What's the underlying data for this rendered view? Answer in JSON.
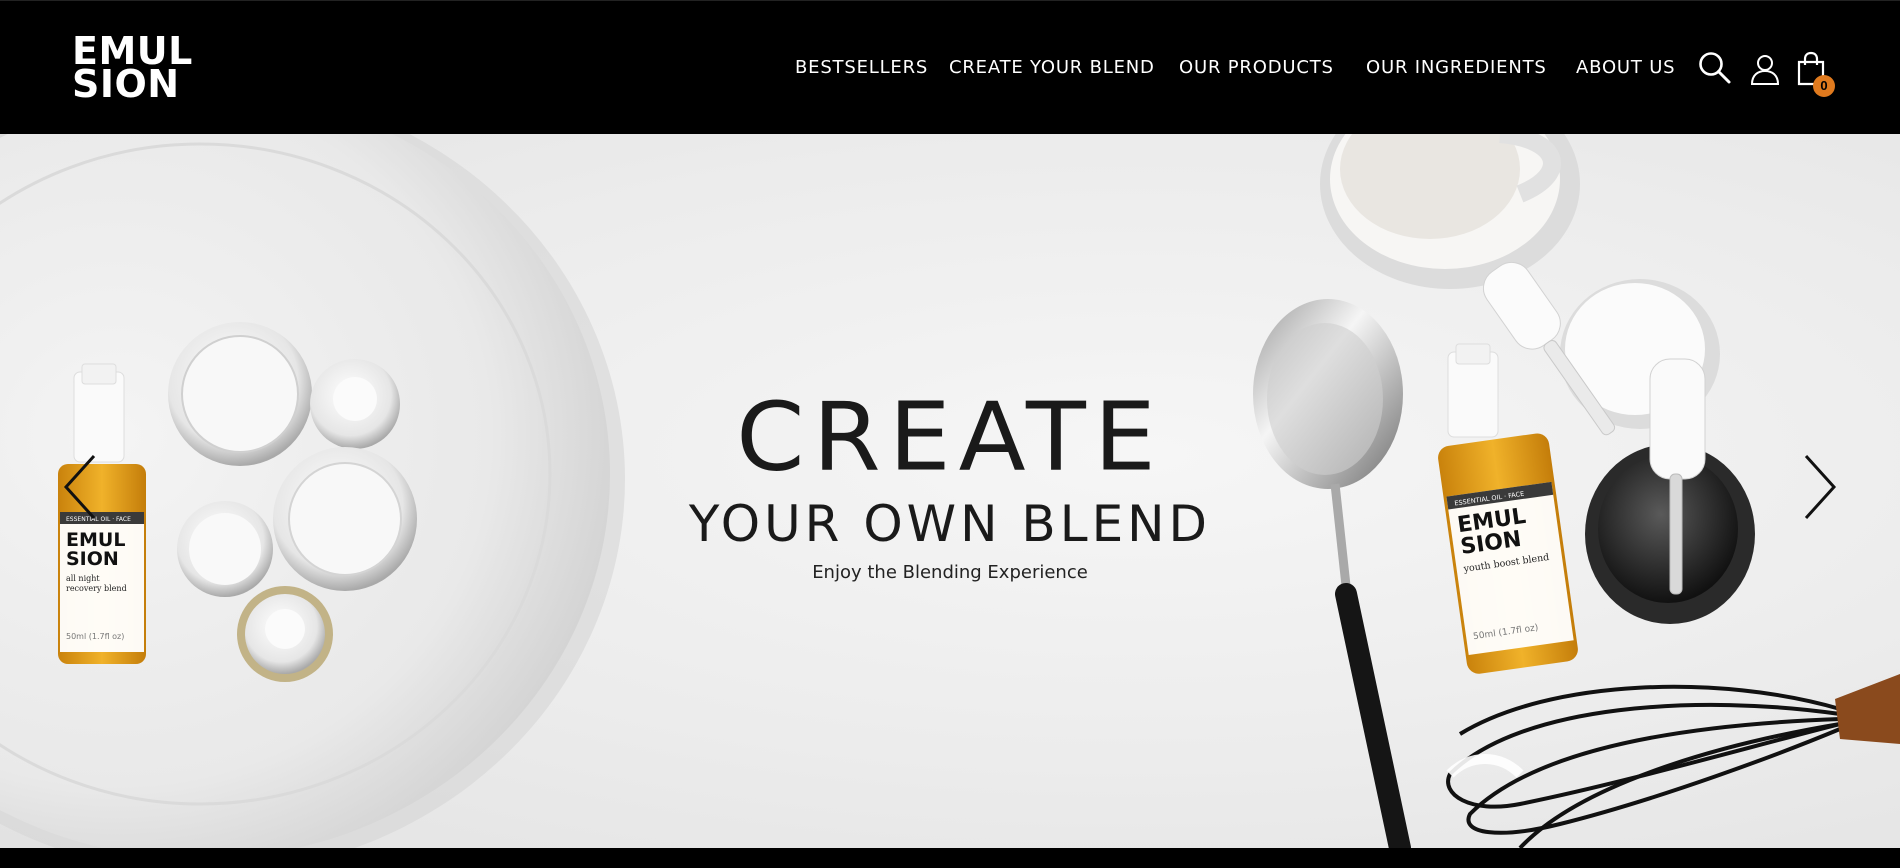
{
  "header": {
    "logo_line1": "EMUL",
    "logo_line2": "SION",
    "nav": [
      {
        "label": "BESTSELLERS"
      },
      {
        "label": "CREATE YOUR BLEND"
      },
      {
        "label": "OUR PRODUCTS"
      },
      {
        "label": "OUR INGREDIENTS"
      },
      {
        "label": "ABOUT US"
      }
    ],
    "icons": {
      "search": "search-icon",
      "account": "user-icon",
      "cart": "shopping-bag-icon"
    },
    "cart_count": "0"
  },
  "hero": {
    "title": "CREATE",
    "subtitle": "YOUR OWN BLEND",
    "tagline": "Enjoy the Blending Experience",
    "prev_icon": "chevron-left-icon",
    "next_icon": "chevron-right-icon",
    "product_left": {
      "brand_line1": "EMUL",
      "brand_line2": "SION",
      "category": "ESSENTIAL OIL · FACE",
      "name_line1": "all night",
      "name_line2": "recovery blend",
      "volume": "50ml (1.7fl oz)"
    },
    "product_right": {
      "brand_line1": "EMUL",
      "brand_line2": "SION",
      "category": "ESSENTIAL OIL · FACE",
      "name": "youth boost blend",
      "volume": "50ml (1.7fl oz)"
    }
  },
  "colors": {
    "header_bg": "#000000",
    "cart_badge": "#e07a1e",
    "oil": "#e8a317"
  }
}
